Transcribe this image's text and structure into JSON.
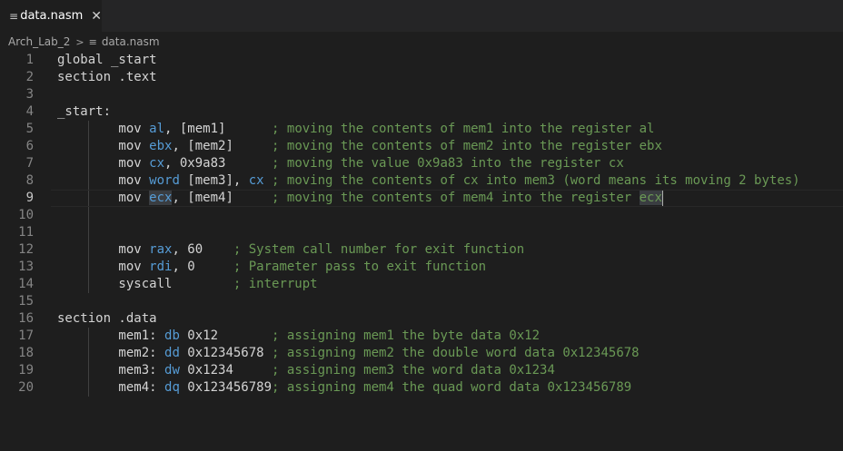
{
  "tab": {
    "icon": "lines-file-icon",
    "label": "data.nasm"
  },
  "breadcrumb": {
    "folder": "Arch_Lab_2",
    "file": "data.nasm",
    "file_icon": "lines-file-icon"
  },
  "editor": {
    "active_line": 9,
    "lines": [
      {
        "n": "1",
        "tokens": [
          {
            "t": "global _start",
            "c": "p"
          }
        ]
      },
      {
        "n": "2",
        "tokens": [
          {
            "t": "section .text",
            "c": "p"
          }
        ]
      },
      {
        "n": "3",
        "tokens": []
      },
      {
        "n": "4",
        "tokens": [
          {
            "t": "_start:",
            "c": "p"
          }
        ]
      },
      {
        "n": "5",
        "tokens": [
          {
            "t": "        mov ",
            "c": "p"
          },
          {
            "t": "al",
            "c": "reg"
          },
          {
            "t": ", [mem1]      ",
            "c": "p"
          },
          {
            "t": "; moving the contents of mem1 into the register al",
            "c": "com"
          }
        ]
      },
      {
        "n": "6",
        "tokens": [
          {
            "t": "        mov ",
            "c": "p"
          },
          {
            "t": "ebx",
            "c": "reg"
          },
          {
            "t": ", [mem2]     ",
            "c": "p"
          },
          {
            "t": "; moving the contents of mem2 into the register ebx",
            "c": "com"
          }
        ]
      },
      {
        "n": "7",
        "tokens": [
          {
            "t": "        mov ",
            "c": "p"
          },
          {
            "t": "cx",
            "c": "reg"
          },
          {
            "t": ", 0x9a83      ",
            "c": "p"
          },
          {
            "t": "; moving the value 0x9a83 into the register cx",
            "c": "com"
          }
        ]
      },
      {
        "n": "8",
        "tokens": [
          {
            "t": "        mov ",
            "c": "p"
          },
          {
            "t": "word",
            "c": "reg"
          },
          {
            "t": " [mem3], ",
            "c": "p"
          },
          {
            "t": "cx",
            "c": "reg"
          },
          {
            "t": " ",
            "c": "p"
          },
          {
            "t": "; moving the contents of cx into mem3 (word means its moving 2 bytes)",
            "c": "com"
          }
        ]
      },
      {
        "n": "9",
        "tokens": [
          {
            "t": "        mov ",
            "c": "p"
          },
          {
            "t": "ecx",
            "c": "reg hl"
          },
          {
            "t": ", [mem4]     ",
            "c": "p"
          },
          {
            "t": "; moving the contents of mem4 into the register ",
            "c": "com"
          },
          {
            "t": "ecx",
            "c": "com hl"
          }
        ]
      },
      {
        "n": "10",
        "tokens": []
      },
      {
        "n": "11",
        "tokens": []
      },
      {
        "n": "12",
        "tokens": [
          {
            "t": "        mov ",
            "c": "p"
          },
          {
            "t": "rax",
            "c": "reg"
          },
          {
            "t": ", 60    ",
            "c": "p"
          },
          {
            "t": "; System call number for exit function",
            "c": "com"
          }
        ]
      },
      {
        "n": "13",
        "tokens": [
          {
            "t": "        mov ",
            "c": "p"
          },
          {
            "t": "rdi",
            "c": "reg"
          },
          {
            "t": ", 0     ",
            "c": "p"
          },
          {
            "t": "; Parameter pass to exit function",
            "c": "com"
          }
        ]
      },
      {
        "n": "14",
        "tokens": [
          {
            "t": "        syscall        ",
            "c": "p"
          },
          {
            "t": "; interrupt",
            "c": "com"
          }
        ]
      },
      {
        "n": "15",
        "tokens": []
      },
      {
        "n": "16",
        "tokens": [
          {
            "t": "section .data",
            "c": "p"
          }
        ]
      },
      {
        "n": "17",
        "tokens": [
          {
            "t": "        mem1: ",
            "c": "p"
          },
          {
            "t": "db",
            "c": "reg"
          },
          {
            "t": " 0x12       ",
            "c": "p"
          },
          {
            "t": "; assigning mem1 the byte data 0x12",
            "c": "com"
          }
        ]
      },
      {
        "n": "18",
        "tokens": [
          {
            "t": "        mem2: ",
            "c": "p"
          },
          {
            "t": "dd",
            "c": "reg"
          },
          {
            "t": " 0x12345678 ",
            "c": "p"
          },
          {
            "t": "; assigning mem2 the double word data 0x12345678",
            "c": "com"
          }
        ]
      },
      {
        "n": "19",
        "tokens": [
          {
            "t": "        mem3: ",
            "c": "p"
          },
          {
            "t": "dw",
            "c": "reg"
          },
          {
            "t": " 0x1234     ",
            "c": "p"
          },
          {
            "t": "; assigning mem3 the word data 0x1234",
            "c": "com"
          }
        ]
      },
      {
        "n": "20",
        "tokens": [
          {
            "t": "        mem4: ",
            "c": "p"
          },
          {
            "t": "dq",
            "c": "reg"
          },
          {
            "t": " 0x123456789",
            "c": "p"
          },
          {
            "t": "; assigning mem4 the quad word data 0x123456789",
            "c": "com"
          }
        ]
      }
    ]
  },
  "colors": {
    "background": "#1e1e1e",
    "keyword": "#569cd6",
    "comment": "#6a9955",
    "text": "#d4d4d4"
  }
}
